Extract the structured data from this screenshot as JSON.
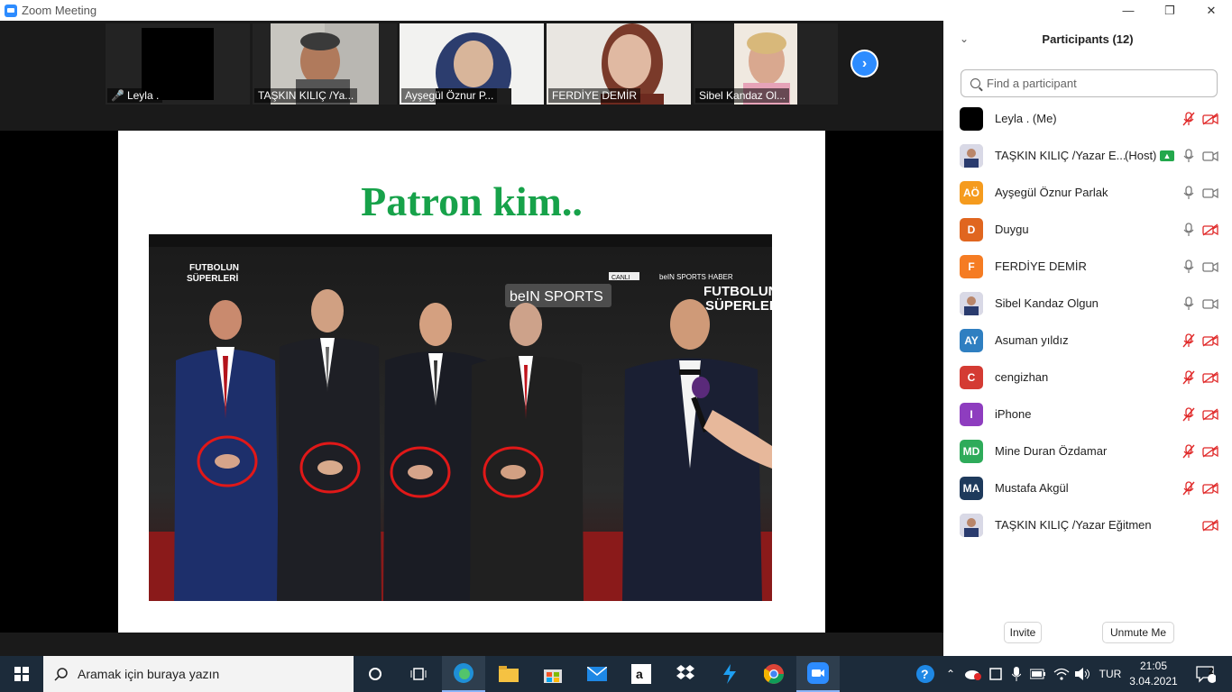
{
  "window": {
    "title": "Zoom Meeting"
  },
  "gallery": {
    "tiles": [
      {
        "name": "Leyla .",
        "muted": true
      },
      {
        "name": "TAŞKIN KILIÇ /Ya..."
      },
      {
        "name": "Ayşegül Öznur P..."
      },
      {
        "name": "FERDİYE DEMİR"
      },
      {
        "name": "Sibel Kandaz Ol..."
      }
    ]
  },
  "slide": {
    "title": "Patron kim..",
    "photo_texts": {
      "brand1": "FUTBOLUN",
      "brand2": "SÜPERLERİ",
      "bein": "beIN SPORTS",
      "canli": "CANLI",
      "haber": "beIN SPORTS HABER",
      "brand3": "FUTBOLUN",
      "brand4": "SÜPERLERİ"
    }
  },
  "participants": {
    "header": "Participants (12)",
    "search_placeholder": "Find a participant",
    "list": [
      {
        "name": "Leyla . (Me)",
        "initials": "",
        "avatar_color": "#000000",
        "mic": "muted",
        "cam": "off"
      },
      {
        "name": "TAŞKIN KILIÇ /Yazar E...",
        "role": "(Host)",
        "initials": "",
        "avatar_color": "photo",
        "mic": "on",
        "cam": "on",
        "sharing": true
      },
      {
        "name": "Ayşegül Öznur Parlak",
        "initials": "AÖ",
        "avatar_color": "#f59b1e",
        "mic": "on",
        "cam": "on"
      },
      {
        "name": "Duygu",
        "initials": "D",
        "avatar_color": "#e0661f",
        "mic": "on",
        "cam": "off"
      },
      {
        "name": "FERDİYE DEMİR",
        "initials": "F",
        "avatar_color": "#f57c23",
        "mic": "on",
        "cam": "on"
      },
      {
        "name": "Sibel Kandaz Olgun",
        "initials": "",
        "avatar_color": "photo",
        "mic": "on",
        "cam": "on"
      },
      {
        "name": "Asuman yıldız",
        "initials": "AY",
        "avatar_color": "#2f7fc1",
        "mic": "muted",
        "cam": "off"
      },
      {
        "name": "cengizhan",
        "initials": "C",
        "avatar_color": "#d43b33",
        "mic": "muted",
        "cam": "off"
      },
      {
        "name": "iPhone",
        "initials": "I",
        "avatar_color": "#8e3dbf",
        "mic": "muted",
        "cam": "off"
      },
      {
        "name": "Mine Duran Özdamar",
        "initials": "MD",
        "avatar_color": "#2eab5a",
        "mic": "muted",
        "cam": "off"
      },
      {
        "name": "Mustafa Akgül",
        "initials": "MA",
        "avatar_color": "#1e3a5c",
        "mic": "muted",
        "cam": "off"
      },
      {
        "name": "TAŞKIN KILIÇ /Yazar Eğitmen",
        "initials": "",
        "avatar_color": "photo",
        "mic": "none",
        "cam": "off"
      }
    ],
    "invite_label": "Invite",
    "unmute_label": "Unmute Me"
  },
  "taskbar": {
    "search_placeholder": "Aramak için buraya yazın",
    "language": "TUR",
    "time": "21:05",
    "date": "3.04.2021",
    "notification_count": "2",
    "icons": [
      "task-view-icon",
      "timeline-icon",
      "edge-icon",
      "file-explorer-icon",
      "store-icon",
      "mail-icon",
      "amazon-icon",
      "dropbox-icon",
      "app-icon",
      "chrome-icon",
      "zoom-icon"
    ]
  }
}
